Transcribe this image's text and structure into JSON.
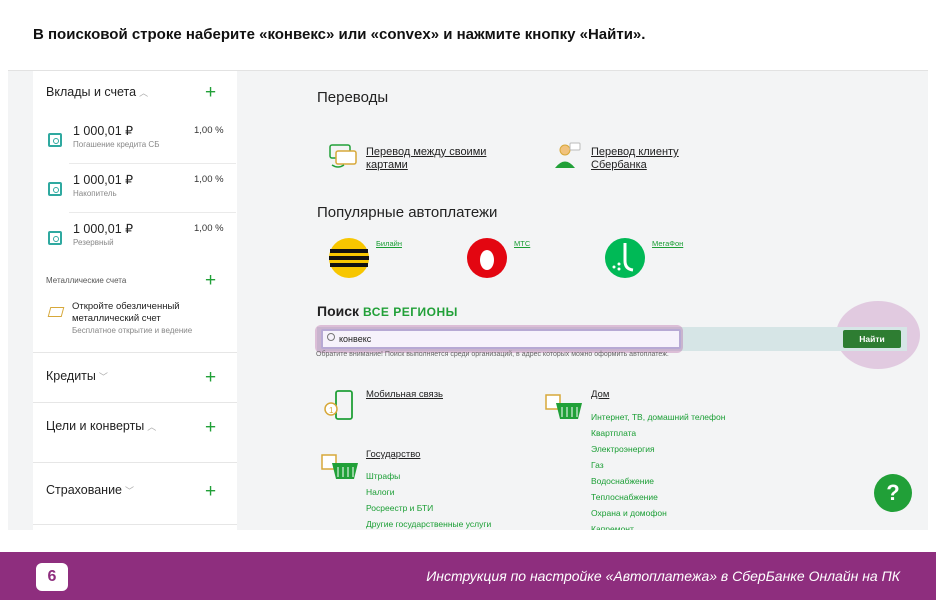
{
  "instruction": "В поисковой строке наберите «конвекс» или «convex» и нажмите кнопку «Найти».",
  "sidebar": {
    "deposits_title": "Вклады и счета",
    "accounts": [
      {
        "amount": "1 000,01 ₽",
        "sub": "Погашение кредита СБ",
        "rate": "1,00 %"
      },
      {
        "amount": "1 000,01 ₽",
        "sub": "Накопитель",
        "rate": "1,00 %"
      },
      {
        "amount": "1 000,01 ₽",
        "sub": "Резервный",
        "rate": "1,00 %"
      }
    ],
    "metal_title": "Металлические счета",
    "metal_offer": "Откройте обезличенный металлический счет",
    "metal_sub": "Бесплатное открытие и ведение",
    "credits": "Кредиты",
    "goals": "Цели и конверты",
    "insurance": "Страхование"
  },
  "main": {
    "transfers_title": "Переводы",
    "transfer_own": "Перевод между своими картами",
    "transfer_client": "Перевод клиенту Сбербанка",
    "autopay_title": "Популярные автоплатежи",
    "autopay": [
      {
        "label": "Билайн"
      },
      {
        "label": "МТС"
      },
      {
        "label": "МегаФон"
      }
    ],
    "search_title": "Поиск",
    "search_region": "ВСЕ РЕГИОНЫ",
    "search_value": "конвекс",
    "search_button": "Найти",
    "notice": "Обратите внимание! Поиск выполняется среди организаций, в адрес которых можно оформить автоплатеж.",
    "categories": {
      "mobile": "Мобильная связь",
      "home": "Дом",
      "home_items": [
        "Интернет, ТВ, домашний телефон",
        "Квартплата",
        "Электроэнергия",
        "Газ",
        "Водоснабжение",
        "Теплоснабжение",
        "Охрана и домофон",
        "Капремонт"
      ],
      "state": "Государство",
      "state_items": [
        "Штрафы",
        "Налоги",
        "Росреестр и БТИ",
        "Другие государственные услуги"
      ]
    },
    "help": "?"
  },
  "footer": {
    "page": "6",
    "text": "Инструкция по настройке «Автоплатежа» в СберБанке Онлайн на ПК"
  },
  "colors": {
    "accent": "#21a038",
    "footer": "#8e2e7e",
    "button": "#2e7d32"
  }
}
